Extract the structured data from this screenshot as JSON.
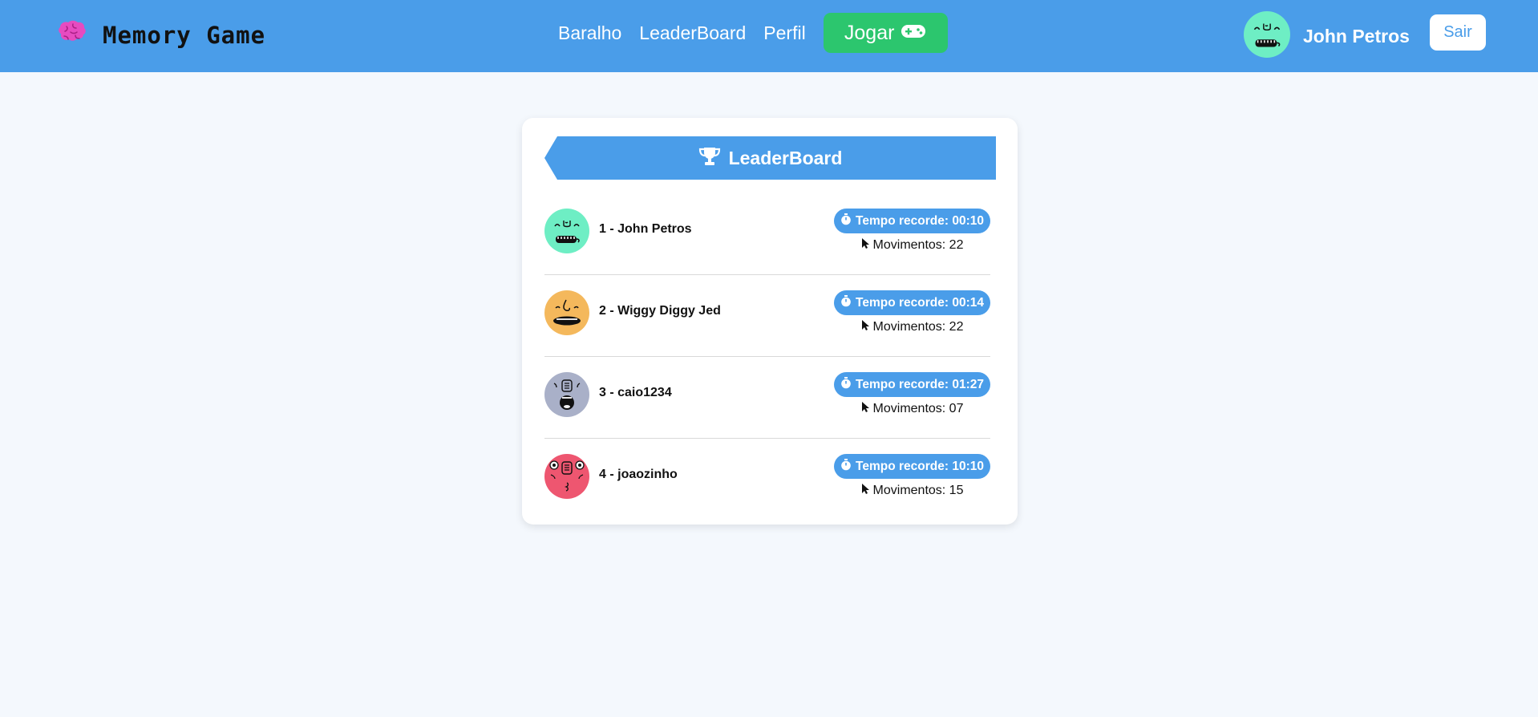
{
  "navbar": {
    "brand_icon": "brain-icon",
    "brand_title": "Memory Game",
    "links": [
      "Baralho",
      "LeaderBoard",
      "Perfil"
    ],
    "play_label": "Jogar",
    "play_icon": "gamepad-icon",
    "user_name": "John Petros",
    "logout_label": "Sair",
    "colors": {
      "bar": "#4a9de9",
      "play": "#2cc66e",
      "brand_icon": "#e64bc0"
    }
  },
  "leaderboard": {
    "title": "LeaderBoard",
    "title_icon": "trophy-icon",
    "entries": [
      {
        "name": "1 - John Petros",
        "record": "Tempo recorde: 00:10",
        "moves_label": "Movimentos: 22",
        "avatar_color": "#6eeec4"
      },
      {
        "name": "2 - Wiggy Diggy Jed",
        "record": "Tempo recorde: 00:14",
        "moves_label": "Movimentos: 22",
        "avatar_color": "#f4b85c"
      },
      {
        "name": "3 - caio1234",
        "record": "Tempo recorde: 01:27",
        "moves_label": "Movimentos: 07",
        "avatar_color": "#a9b0c8"
      },
      {
        "name": "4 - joaozinho",
        "record": "Tempo recorde: 10:10",
        "moves_label": "Movimentos: 15",
        "avatar_color": "#ee5670"
      }
    ]
  }
}
